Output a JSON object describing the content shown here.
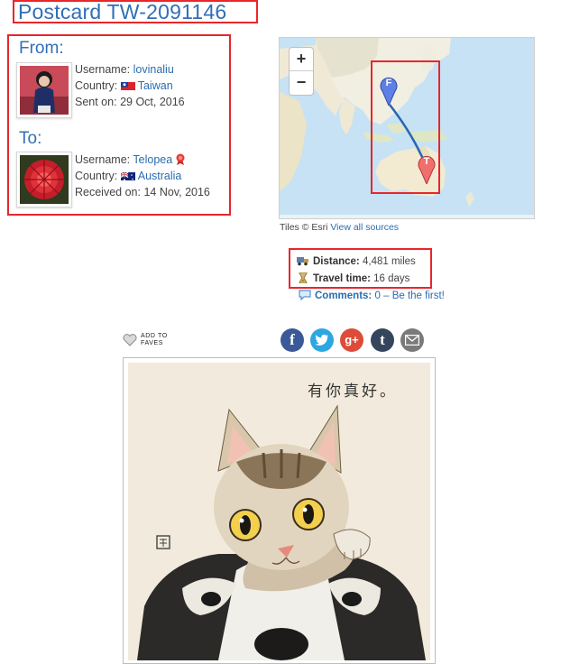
{
  "title": "Postcard TW-2091146",
  "from": {
    "heading": "From:",
    "username_label": "Username:",
    "username": "lovinaliu",
    "country_label": "Country:",
    "country": "Taiwan",
    "date_label": "Sent on:",
    "date": "29 Oct, 2016"
  },
  "to": {
    "heading": "To:",
    "username_label": "Username:",
    "username": "Telopea",
    "country_label": "Country:",
    "country": "Australia",
    "date_label": "Received on:",
    "date": "14 Nov, 2016"
  },
  "map": {
    "zoom_in": "+",
    "zoom_out": "−",
    "from_marker": "F",
    "to_marker": "T",
    "tiles_prefix": "Tiles © Esri",
    "tiles_link": "View all sources"
  },
  "stats": {
    "distance_label": "Distance:",
    "distance": "4,481 miles",
    "travel_label": "Travel time:",
    "travel": "16 days",
    "comments_label": "Comments:",
    "comments_count": "0",
    "comments_separator": "–",
    "comments_link": "Be the first!"
  },
  "actions": {
    "faves_line1": "ADD TO",
    "faves_line2": "FAVES",
    "share_google": "g+",
    "share_tumblr": "t"
  },
  "postcard": {
    "caption": "有你真好。"
  },
  "colors": {
    "link": "#2a6db0",
    "annotation": "#e8262b",
    "facebook": "#3b5998",
    "twitter": "#2ca7e0",
    "google": "#dd4b39",
    "tumblr": "#35465c",
    "email": "#7a7a7a"
  }
}
